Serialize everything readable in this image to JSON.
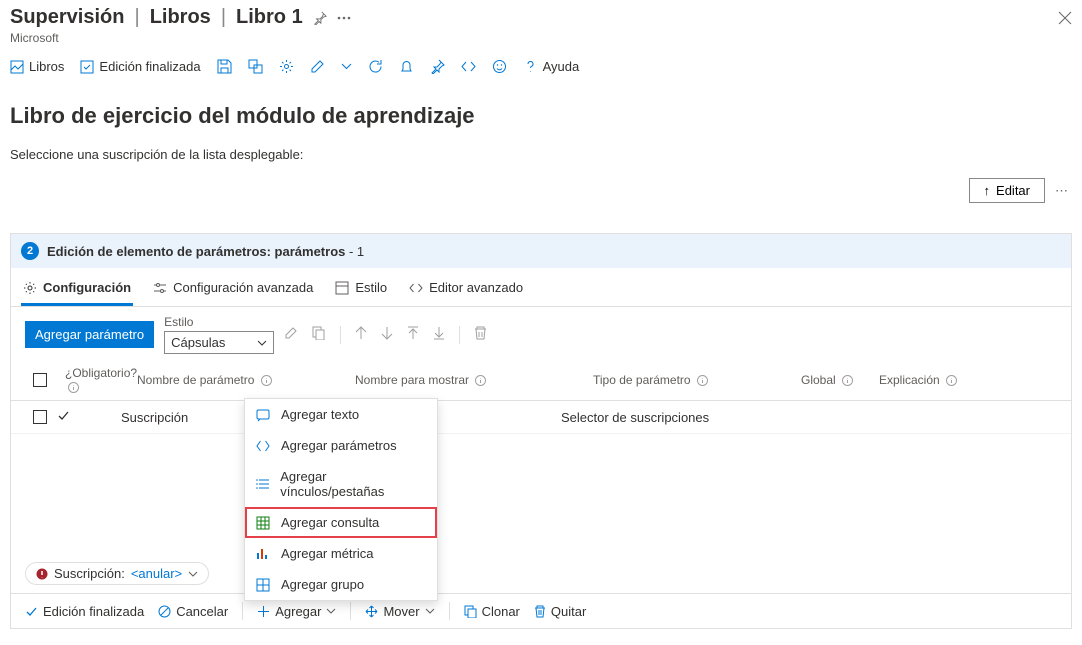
{
  "header": {
    "breadcrumb": [
      "Supervisión",
      "Libros",
      "Libro 1"
    ],
    "subtitle": "Microsoft"
  },
  "commandbar": {
    "libros": "Libros",
    "edicion_finalizada": "Edición finalizada",
    "ayuda": "Ayuda"
  },
  "main": {
    "title": "Libro de ejercicio del módulo de aprendizaje",
    "desc": "Seleccione una suscripción de la lista desplegable:",
    "edit_label": "Editar"
  },
  "panel": {
    "step": "2",
    "header_bold": "Edición de elemento de parámetros: parámetros",
    "header_suffix": " - 1",
    "pivot": {
      "config": "Configuración",
      "config_adv": "Configuración avanzada",
      "estilo": "Estilo",
      "editor_adv": "Editor avanzado"
    },
    "add_param": "Agregar parámetro",
    "style_label": "Estilo",
    "style_value": "Cápsulas",
    "columns": {
      "req": "¿Obligatorio?",
      "paramname": "Nombre de parámetro",
      "displayname": "Nombre para mostrar",
      "paramtype": "Tipo de parámetro",
      "global": "Global",
      "expl": "Explicación"
    },
    "row": {
      "paramname": "Suscripción",
      "paramtype": "Selector de suscripciones"
    },
    "status": {
      "label": "Suscripción:",
      "value": "<anular>"
    }
  },
  "bottom": {
    "edicion": "Edición finalizada",
    "cancelar": "Cancelar",
    "agregar": "Agregar",
    "mover": "Mover",
    "clonar": "Clonar",
    "quitar": "Quitar"
  },
  "context_menu": {
    "items": [
      {
        "label": "Agregar texto"
      },
      {
        "label": "Agregar parámetros"
      },
      {
        "label": "Agregar vínculos/pestañas"
      },
      {
        "label": "Agregar consulta"
      },
      {
        "label": "Agregar métrica"
      },
      {
        "label": "Agregar grupo"
      }
    ]
  },
  "colors": {
    "primary": "#0078d4",
    "highlight": "#e3404a"
  }
}
